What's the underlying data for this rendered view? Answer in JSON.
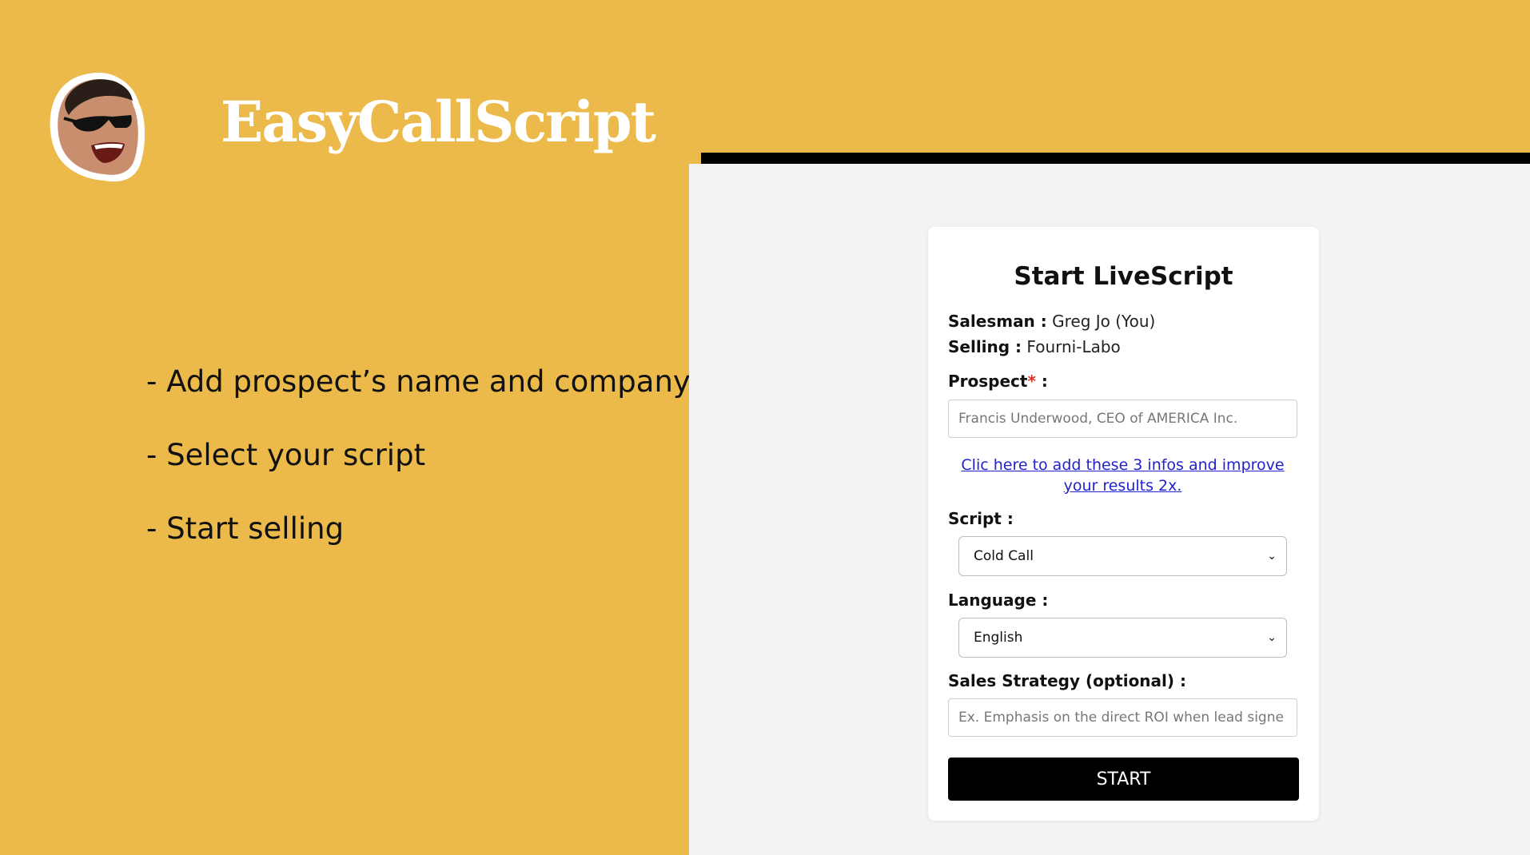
{
  "brand": {
    "name": "EasyCallScript"
  },
  "steps": [
    "- Add prospect’s name and company",
    "- Select your script",
    "- Start selling"
  ],
  "form": {
    "title": "Start LiveScript",
    "salesman_label": "Salesman :",
    "salesman_value": "Greg Jo (You)",
    "selling_label": "Selling :",
    "selling_value": "Fourni-Labo",
    "prospect_label": "Prospect",
    "prospect_required": "*",
    "prospect_colon": " :",
    "prospect_placeholder": "Francis Underwood, CEO of AMERICA Inc.",
    "link_text": "Clic here to add these 3 infos and improve your results 2x.",
    "script_label": "Script :",
    "script_value": "Cold Call",
    "language_label": "Language :",
    "language_value": "English",
    "strategy_label": "Sales Strategy (optional) :",
    "strategy_placeholder": "Ex. Emphasis on the direct ROI when lead signe",
    "start_label": "START"
  },
  "colors": {
    "background": "#EBBA4A",
    "panel": "#F3F3F3",
    "button": "#000000",
    "link": "#2222CC",
    "required": "#D93025"
  }
}
